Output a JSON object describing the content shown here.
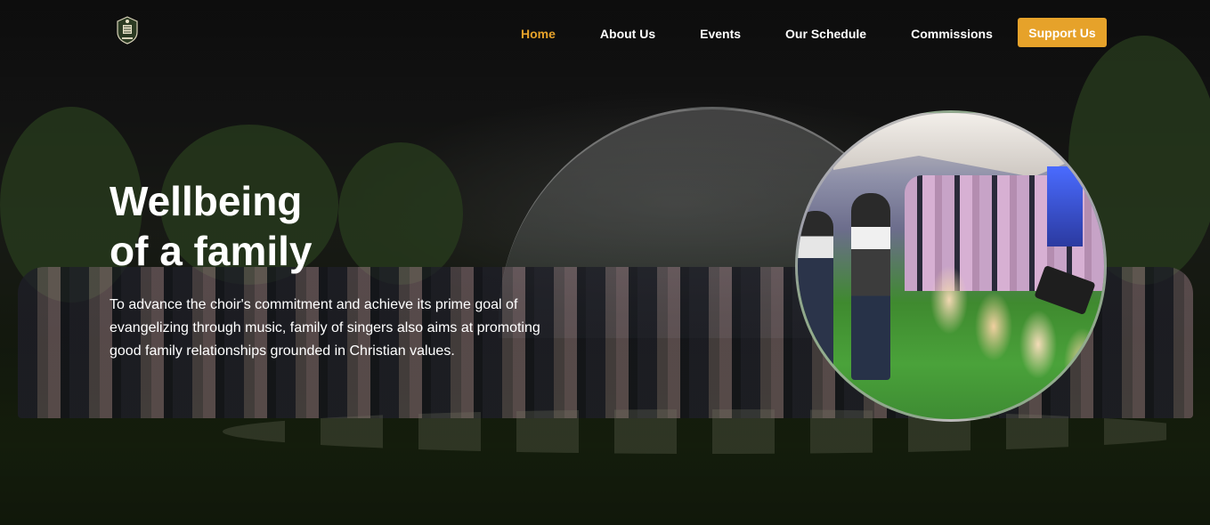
{
  "header": {
    "nav": [
      {
        "label": "Home",
        "active": true
      },
      {
        "label": "About Us",
        "active": false
      },
      {
        "label": "Events",
        "active": false
      },
      {
        "label": "Our Schedule",
        "active": false
      },
      {
        "label": "Commissions",
        "active": false
      }
    ],
    "cta_label": "Support Us"
  },
  "hero": {
    "title_line1": "Wellbeing",
    "title_line2": "of a family",
    "text": "To advance the choir's commitment and achieve its prime goal of evangelizing through music, family of singers also aims at promoting good family relationships grounded in Christian values."
  },
  "colors": {
    "accent": "#e6a22a",
    "text": "#ffffff",
    "background": "#141414"
  },
  "icons": {
    "logo": "choir-crest-logo"
  }
}
